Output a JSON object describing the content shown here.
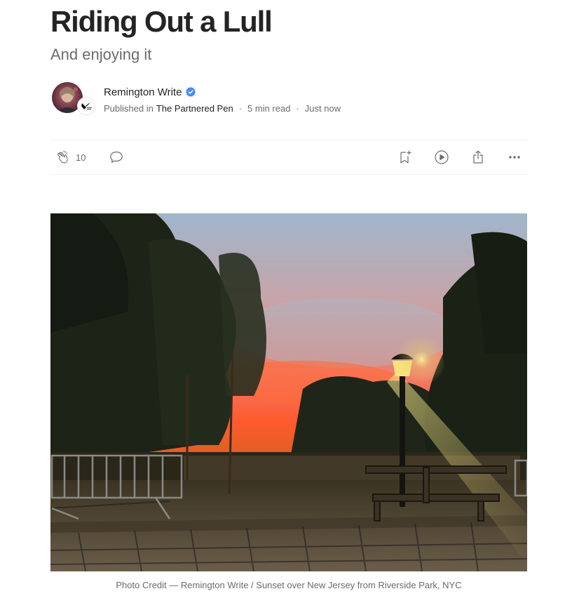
{
  "article": {
    "title": "Riding Out a Lull",
    "subtitle": "And enjoying it"
  },
  "byline": {
    "author_name": "Remington Write",
    "verified_badge_icon": "verified-badge-icon",
    "published_in_label": "Published in",
    "publication_name": "The Partnered Pen",
    "read_time": "5 min read",
    "published_time": "Just now",
    "separator": "·"
  },
  "actions": {
    "clap_icon": "clap-icon",
    "clap_count": "10",
    "response_icon": "speech-bubble-icon",
    "save_icon": "bookmark-add-icon",
    "listen_icon": "play-circle-icon",
    "share_icon": "share-icon",
    "more_icon": "more-dots-icon"
  },
  "hero_image": {
    "description_icon": "sunset-photo",
    "caption": "Photo Credit — Remington Write / Sunset over New Jersey from Riverside Park, NYC"
  },
  "colors": {
    "text_primary": "#242424",
    "text_secondary": "#6b6b6b",
    "verified_blue": "#4A8AF4",
    "divider": "#f0f0f0"
  }
}
